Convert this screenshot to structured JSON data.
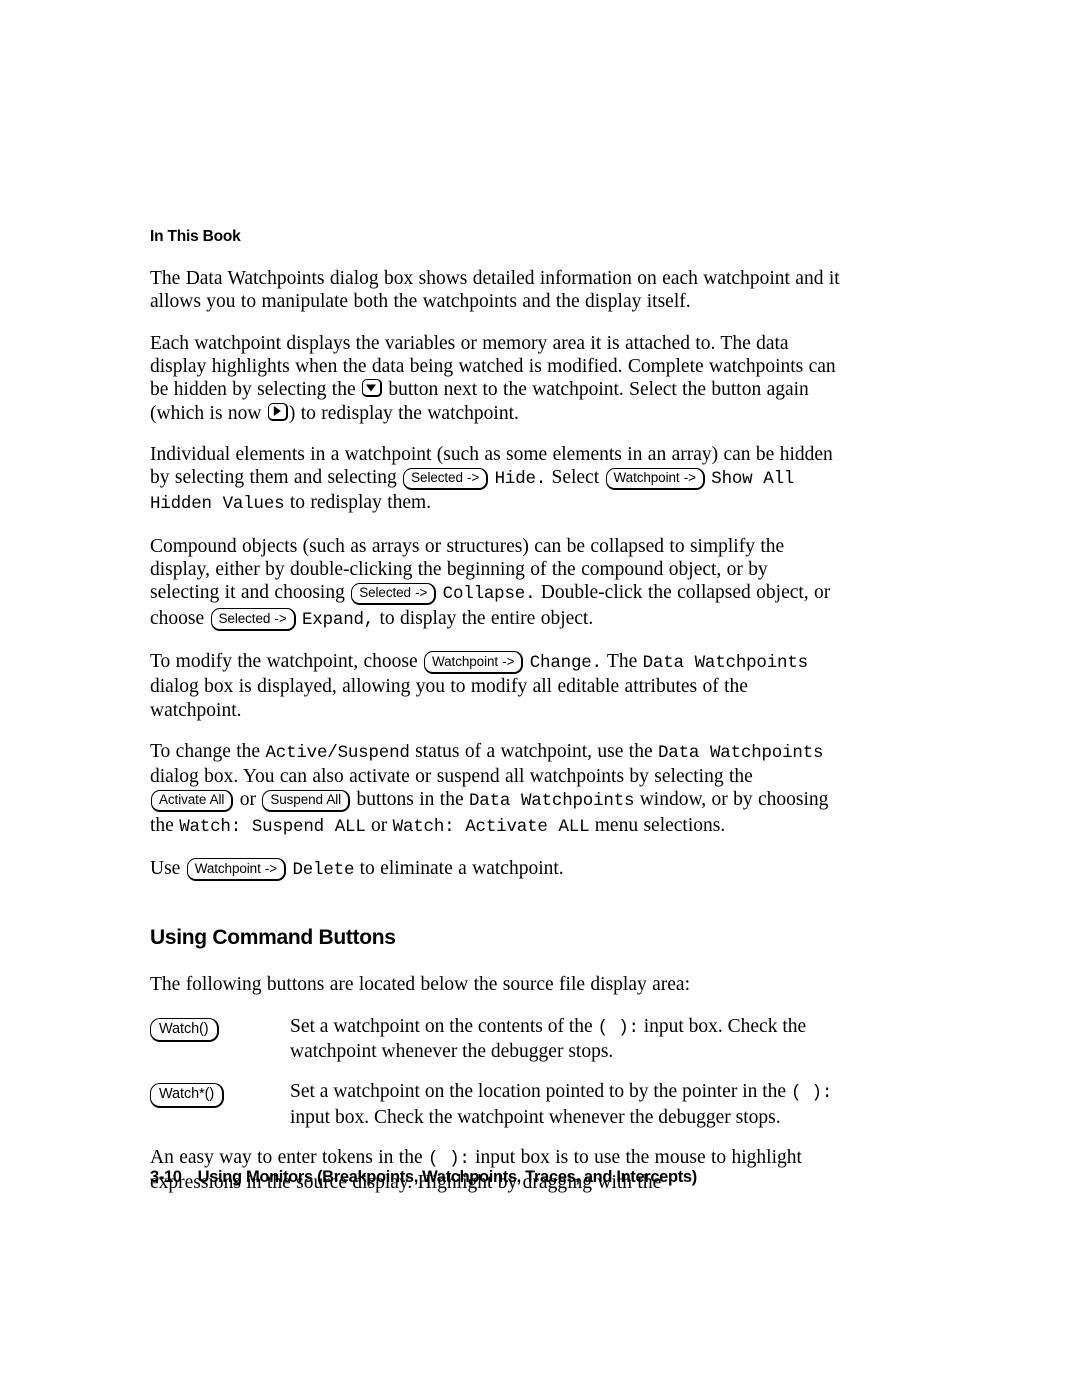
{
  "document": {
    "page_number": "3-10",
    "footer_title": "Using Monitors (Breakpoints, Watchpoints, Traces, and Intercepts)"
  },
  "headings": {
    "in_this_book": "In This Book",
    "using_command_buttons": "Using Command Buttons"
  },
  "paragraphs": {
    "p1": "The Data Watchpoints dialog box shows detailed information on each watchpoint and it allows you to manipulate both the watchpoints and the display itself.",
    "p2_a": "Each watchpoint displays the variables or memory area it is attached to. The data display highlights when the data being watched is modified. Complete watchpoints can be hidden by selecting the",
    "p2_b": "button next to the watchpoint. Select the button again (which is now",
    "p2_c": ") to redisplay the watchpoint.",
    "p3_a": "Individual elements in a watchpoint (such as some elements in an array) can be hidden by selecting them and selecting",
    "p3_b": "Hide.",
    "p3_c": "Select",
    "p3_d": "Show All Hidden Values",
    "p3_e": "to redisplay them.",
    "p4_a": "Compound objects (such as arrays or structures) can be collapsed to simplify the display, either by double-clicking the beginning of the compound object, or by selecting it and choosing",
    "p4_b": "Collapse.",
    "p4_c": "Double-click the collapsed object, or choose",
    "p4_d": "Expand,",
    "p4_e": "to display the entire object.",
    "p5_a": "To modify the watchpoint, choose",
    "p5_b": "Change.",
    "p5_c": "The",
    "p5_d": "Data Watchpoints",
    "p5_e": "dialog box is displayed, allowing you to modify all editable attributes of the watchpoint.",
    "p6_a": "To change the",
    "p6_b": "Active/Suspend",
    "p6_c": "status of a watchpoint, use the",
    "p6_d": "Data Watchpoints",
    "p6_e": "dialog box. You can also activate or suspend all watchpoints by selecting the",
    "p6_f": "or",
    "p6_g": "buttons in the",
    "p6_h": "Data Watchpoints",
    "p6_i": "window, or by choosing the",
    "p6_j": "Watch: Suspend ALL",
    "p6_k": "or",
    "p6_l": "Watch: Activate ALL",
    "p6_m": "menu selections.",
    "p7_a": "Use",
    "p7_b": "Delete",
    "p7_c": "to eliminate a watchpoint.",
    "p8": "The following buttons are located below the source file display area:",
    "p9_a": "An easy way to enter tokens in the",
    "p9_b": "( ):",
    "p9_c": "input box is to use the mouse to highlight expressions in the source display. Highlight by dragging with the"
  },
  "buttons": {
    "selected_menu": "Selected ->",
    "watchpoint_menu": "Watchpoint ->",
    "activate_all": "Activate All",
    "suspend_all": "Suspend All",
    "watch": "Watch()",
    "watch_star": "Watch*()",
    "hide_triangle_icon": "triangle-down-icon",
    "show_triangle_icon": "triangle-right-icon"
  },
  "command_buttons": [
    {
      "label": "Watch()",
      "desc_a": "Set a watchpoint on the contents of the",
      "desc_code": "( ):",
      "desc_b": "input box. Check the watchpoint whenever the debugger stops."
    },
    {
      "label": "Watch*()",
      "desc_a": "Set a watchpoint on the location pointed to by the pointer in the",
      "desc_code": "( ):",
      "desc_b": "input box. Check the watchpoint whenever the debugger stops."
    }
  ],
  "colors": {
    "text": "#000000",
    "background": "#ffffff"
  }
}
